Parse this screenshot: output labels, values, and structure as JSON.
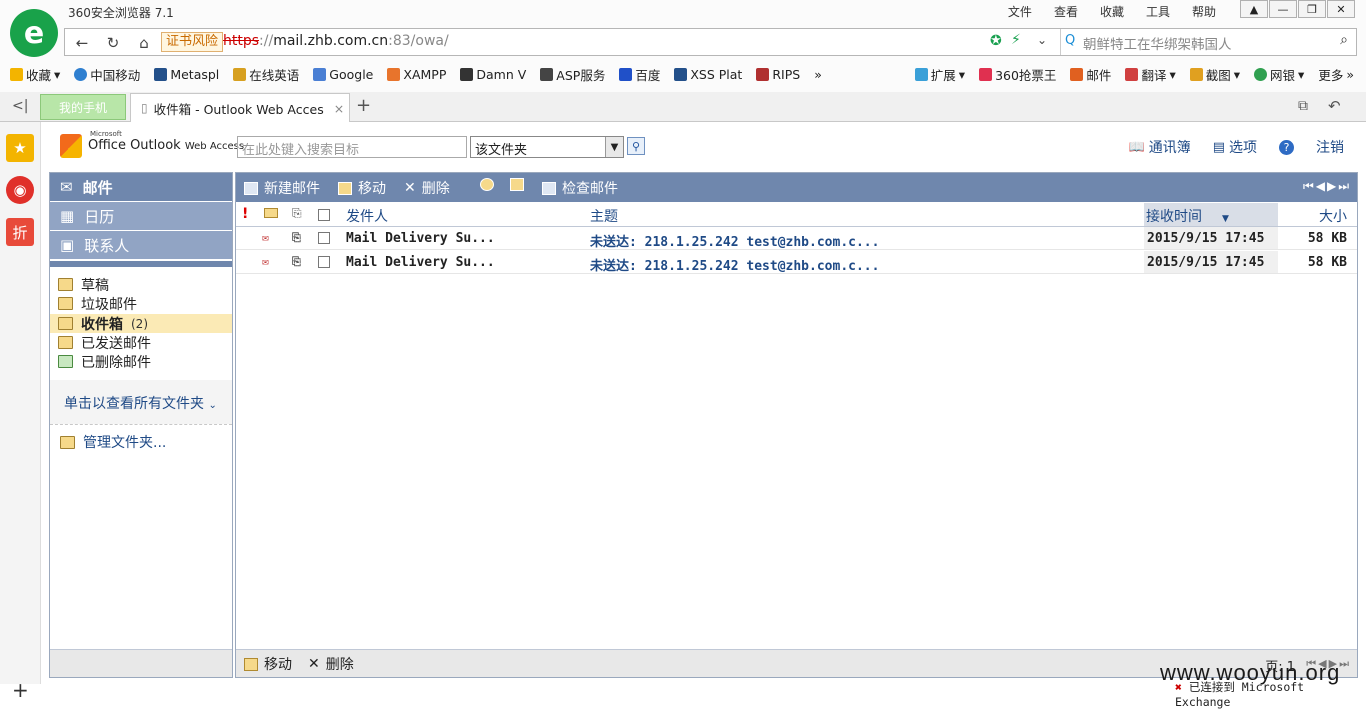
{
  "browser": {
    "title": "360安全浏览器 7.1",
    "menu": [
      "文件",
      "查看",
      "收藏",
      "工具",
      "帮助"
    ],
    "cert_warning": "证书风险",
    "url": {
      "scheme": "https",
      "sep": "://",
      "host": "mail.zhb.com.cn",
      "rest": ":83/owa/"
    },
    "search_placeholder": "朝鲜特工在华绑架韩国人",
    "bookmarks": [
      "收藏",
      "中国移动",
      "Metaspl",
      "在线英语",
      "Google",
      "XAMPP",
      "Damn V",
      "ASP服务",
      "百度",
      "XSS Plat",
      "RIPS"
    ],
    "right_tools": [
      "扩展",
      "360抢票王",
      "邮件",
      "翻译",
      "截图",
      "网银",
      "更多"
    ],
    "tabs": {
      "phone": "我的手机",
      "main": "收件箱 - Outlook Web Acces"
    }
  },
  "owa": {
    "logo_small": "Microsoft",
    "logo_main": "Office Outlook",
    "logo_sub": "Web Access",
    "search_placeholder": "在此处键入搜索目标",
    "scope": "该文件夹",
    "top_links": [
      "通讯簿",
      "选项",
      "注销"
    ],
    "nav": {
      "mail": "邮件",
      "calendar": "日历",
      "contacts": "联系人"
    },
    "folders": [
      {
        "name": "草稿",
        "count": ""
      },
      {
        "name": "垃圾邮件",
        "count": ""
      },
      {
        "name": "收件箱",
        "count": "(2)"
      },
      {
        "name": "已发送邮件",
        "count": ""
      },
      {
        "name": "已删除邮件",
        "count": ""
      }
    ],
    "all_folders": "单击以查看所有文件夹",
    "manage_folders": "管理文件夹...",
    "toolbar": {
      "new": "新建邮件",
      "move": "移动",
      "delete": "删除",
      "check": "检查邮件"
    },
    "columns": {
      "from": "发件人",
      "subject": "主题",
      "received": "接收时间",
      "size": "大小"
    },
    "messages": [
      {
        "from": "Mail Delivery Su...",
        "subject": "未送达: 218.1.25.242 test@zhb.com.c...",
        "received": "2015/9/15 17:45",
        "size": "58 KB"
      },
      {
        "from": "Mail Delivery Su...",
        "subject": "未送达: 218.1.25.242 test@zhb.com.c...",
        "received": "2015/9/15 17:45",
        "size": "58 KB"
      }
    ],
    "bottom": {
      "move": "移动",
      "delete": "删除",
      "page_label": "页: 1"
    },
    "status": "已连接到 Microsoft Exchange"
  },
  "watermark": "www.wooyun.org"
}
